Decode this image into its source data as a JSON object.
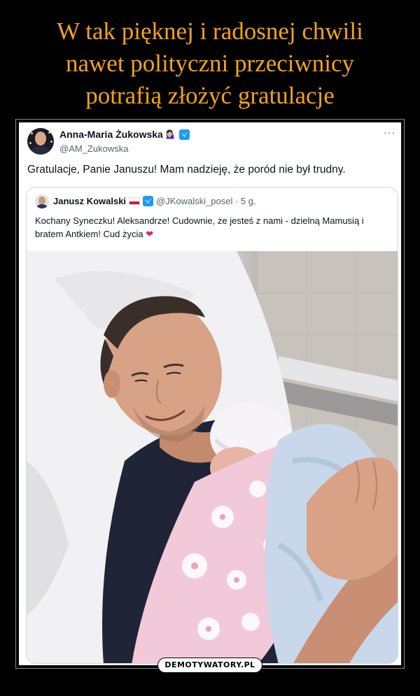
{
  "headline": {
    "line1": "W tak pięknej i radosnej chwili",
    "line2": "nawet polityczni przeciwnicy",
    "line3": "potrafią złożyć gratulacje"
  },
  "tweet": {
    "author_name": "Anna-Maria Żukowska",
    "author_badge_icon": "woman-tipping-hand-emoji",
    "author_handle": "@AM_Zukowska",
    "more_icon": "more-options-icon",
    "text": "Gratulacje, Panie Januszu! Mam nadzieję, że poród nie był trudny."
  },
  "quoted_tweet": {
    "author_name": "Janusz Kowalski",
    "flag_icon": "poland-flag-icon",
    "handle_and_time": "@JKowalski_posel · 5 g.",
    "text": "Kochany Syneczku! Aleksandrze! Cudownie, że jesteś z nami - dzielną Mamusią i bratem Antkiem! Cud życia",
    "heart": "❤",
    "photo_icon": "father-holding-newborn-photo"
  },
  "watermark": "DEMOTYWATORY.PL",
  "colors": {
    "headline": "#f2a319",
    "verified": "#1d9bf0",
    "heart": "#e0245e",
    "background": "#000000"
  }
}
